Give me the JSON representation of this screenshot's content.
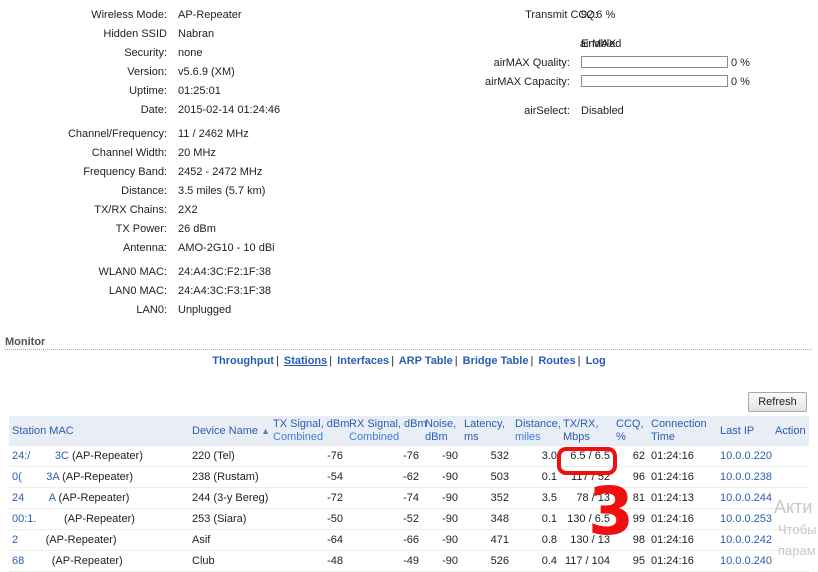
{
  "status_left": [
    {
      "label": "Wireless Mode:",
      "value": "AP-Repeater"
    },
    {
      "label": "Hidden SSID",
      "value": "Nabran"
    },
    {
      "label": "Security:",
      "value": "none"
    },
    {
      "label": "Version:",
      "value": "v5.6.9 (XM)"
    },
    {
      "label": "Uptime:",
      "value": "01:25:01"
    },
    {
      "label": "Date:",
      "value": "2015-02-14 01:24:46"
    },
    {
      "label": "Channel/Frequency:",
      "value": "11 / 2462 MHz"
    },
    {
      "label": "Channel Width:",
      "value": "20 MHz"
    },
    {
      "label": "Frequency Band:",
      "value": "2452 - 2472 MHz"
    },
    {
      "label": "Distance:",
      "value": "3.5 miles (5.7 km)"
    },
    {
      "label": "TX/RX Chains:",
      "value": "2X2"
    },
    {
      "label": "TX Power:",
      "value": "26 dBm"
    },
    {
      "label": "Antenna:",
      "value": "AMO-2G10 - 10 dBi"
    },
    {
      "label": "WLAN0 MAC:",
      "value": "24:A4:3C:F2:1F:38"
    },
    {
      "label": "LAN0 MAC:",
      "value": "24:A4:3C:F3:1F:38"
    },
    {
      "label": "LAN0:",
      "value": "Unplugged"
    }
  ],
  "status_right": {
    "transmit_ccq": {
      "label": "Transmit CCQ:",
      "value": "92.6 %"
    },
    "airmax": {
      "label": "airMAX:",
      "value": "Enabled"
    },
    "airmax_quality": {
      "label": "airMAX Quality:",
      "percent": "0 %",
      "level": 0
    },
    "airmax_capacity": {
      "label": "airMAX Capacity:",
      "percent": "0 %",
      "level": 0
    },
    "airselect": {
      "label": "airSelect:",
      "value": "Disabled"
    }
  },
  "monitor": {
    "title": "Monitor",
    "tabs": [
      "Throughput",
      "Stations",
      "Interfaces",
      "ARP Table",
      "Bridge Table",
      "Routes",
      "Log"
    ],
    "active_tab": "Stations",
    "separator": "|",
    "refresh_label": "Refresh"
  },
  "stations_table": {
    "headers": {
      "mac": "Station MAC",
      "device": "Device Name",
      "tx_signal": "TX Signal, dBm",
      "tx_signal_sub": "Combined",
      "rx_signal": "RX Signal, dBm",
      "rx_signal_sub": "Combined",
      "noise": "Noise,",
      "noise_sub": "dBm",
      "latency": "Latency,",
      "latency_sub": "ms",
      "distance": "Distance,",
      "distance_sub": "miles",
      "txrx": "TX/RX,",
      "txrx_sub": "Mbps",
      "ccq": "CCQ,",
      "ccq_sub": "%",
      "conn": "Connection",
      "conn_sub": "Time",
      "lastip": "Last IP",
      "action": "Action"
    },
    "rows": [
      {
        "mac_start": "24:/",
        "mac_end": "3C",
        "mode": "(AP-Repeater)",
        "device": "220 (Tel)",
        "tx": "-76",
        "rx": "-76",
        "noise": "-90",
        "latency": "532",
        "distance": "3.0",
        "txrx": "6.5 / 6.5",
        "ccq": "62",
        "conn": "01:24:16",
        "ip": "10.0.0.220"
      },
      {
        "mac_start": "0(",
        "mac_end": "3A",
        "mode": "(AP-Repeater)",
        "device": "238 (Rustam)",
        "tx": "-54",
        "rx": "-62",
        "noise": "-90",
        "latency": "503",
        "distance": "0.1",
        "txrx": "117 / 52",
        "ccq": "96",
        "conn": "01:24:16",
        "ip": "10.0.0.238"
      },
      {
        "mac_start": "24",
        "mac_end": "A",
        "mode": "(AP-Repeater)",
        "device": "244 (3-y Bereg)",
        "tx": "-72",
        "rx": "-74",
        "noise": "-90",
        "latency": "352",
        "distance": "3.5",
        "txrx": "78 / 13",
        "ccq": "81",
        "conn": "01:24:13",
        "ip": "10.0.0.244"
      },
      {
        "mac_start": "00:1.",
        "mac_end": "",
        "mode": "(AP-Repeater)",
        "device": "253 (Siara)",
        "tx": "-50",
        "rx": "-52",
        "noise": "-90",
        "latency": "348",
        "distance": "0.1",
        "txrx": "130 / 6.5",
        "ccq": "99",
        "conn": "01:24:16",
        "ip": "10.0.0.253"
      },
      {
        "mac_start": "2",
        "mac_end": "",
        "mode": "(AP-Repeater)",
        "device": "Asif",
        "tx": "-64",
        "rx": "-66",
        "noise": "-90",
        "latency": "471",
        "distance": "0.8",
        "txrx": "130 / 13",
        "ccq": "98",
        "conn": "01:24:16",
        "ip": "10.0.0.242"
      },
      {
        "mac_start": "68",
        "mac_end": "",
        "mode": "(AP-Repeater)",
        "device": "Club",
        "tx": "-48",
        "rx": "-49",
        "noise": "-90",
        "latency": "526",
        "distance": "0.4",
        "txrx": "117 / 104",
        "ccq": "95",
        "conn": "01:24:16",
        "ip": "10.0.0.240"
      }
    ]
  },
  "annotation": {
    "digit": "3"
  },
  "watermark": {
    "line1": "Акти",
    "line2": "Чтобы",
    "line3": "парам"
  },
  "colors": {
    "link": "#2a5db0",
    "header_bg": "#e9eef6",
    "annotation": "#f00f0f"
  }
}
